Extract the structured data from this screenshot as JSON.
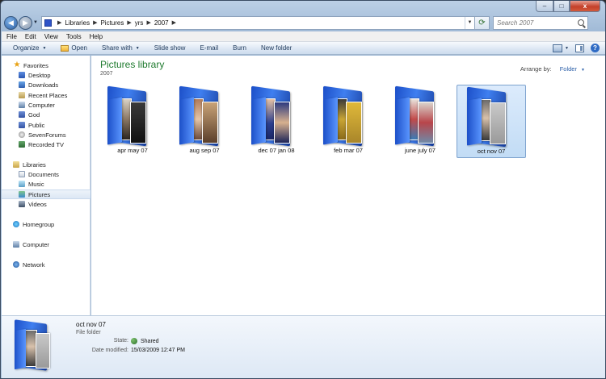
{
  "window": {
    "caption_buttons": {
      "minimize": "–",
      "maximize": "□",
      "close": "x"
    }
  },
  "address_bar": {
    "breadcrumbs": [
      "Libraries",
      "Pictures",
      "yrs",
      "2007"
    ],
    "search_placeholder": "Search 2007"
  },
  "menu": [
    "File",
    "Edit",
    "View",
    "Tools",
    "Help"
  ],
  "toolbar": {
    "items": [
      {
        "label": "Organize",
        "dropdown": true
      },
      {
        "label": "Open",
        "icon": "open-icon"
      },
      {
        "label": "Share with",
        "dropdown": true
      },
      {
        "label": "Slide show"
      },
      {
        "label": "E-mail"
      },
      {
        "label": "Burn"
      },
      {
        "label": "New folder"
      }
    ],
    "help": "?"
  },
  "nav_pane": {
    "favorites_label": "Favorites",
    "favorites": [
      "Desktop",
      "Downloads",
      "Recent Places",
      "Computer",
      "God",
      "Public",
      "SevenForums",
      "Recorded TV"
    ],
    "libraries_label": "Libraries",
    "libraries": [
      "Documents",
      "Music",
      "Pictures",
      "Videos"
    ],
    "selected": "Pictures",
    "homegroup": "Homegroup",
    "computer": "Computer",
    "network": "Network"
  },
  "library": {
    "title": "Pictures library",
    "subtitle": "2007",
    "arrange_label": "Arrange by:",
    "arrange_value": "Folder"
  },
  "folders": [
    {
      "name": "apr may 07",
      "selected": false
    },
    {
      "name": "aug sep 07",
      "selected": false
    },
    {
      "name": "dec 07 jan 08",
      "selected": false
    },
    {
      "name": "feb mar 07",
      "selected": false
    },
    {
      "name": "june july 07",
      "selected": false
    },
    {
      "name": "oct nov 07",
      "selected": true
    }
  ],
  "details": {
    "name": "oct nov 07",
    "type": "File folder",
    "state_label": "State:",
    "state_value": "Shared",
    "modified_label": "Date modified:",
    "modified_value": "15/03/2009 12:47 PM"
  },
  "colors": {
    "accent": "#1e7a2e",
    "folder_blue": "#2f6be0",
    "selection": "#c2dcf5"
  }
}
